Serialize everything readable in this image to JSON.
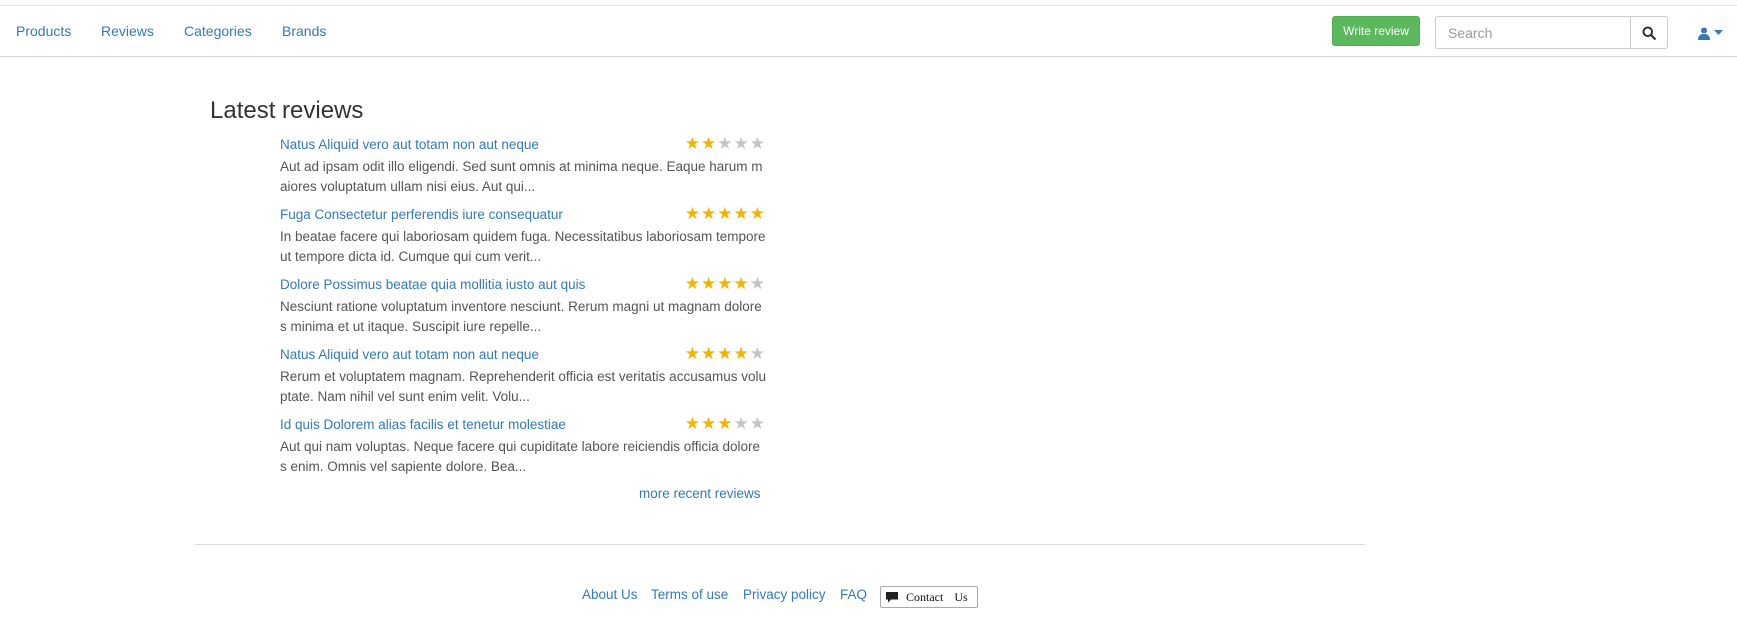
{
  "nav": {
    "items": [
      {
        "label": "Products"
      },
      {
        "label": "Reviews"
      },
      {
        "label": "Categories"
      },
      {
        "label": "Brands"
      }
    ],
    "write_review_label": "Write review",
    "search_placeholder": "Search"
  },
  "main": {
    "heading": "Latest reviews",
    "reviews": [
      {
        "title": "Natus Aliquid vero aut totam non aut neque",
        "rating": 2,
        "max_rating": 5,
        "body": "Aut ad ipsam odit illo eligendi. Sed sunt omnis at minima neque. Eaque harum maiores voluptatum ullam nisi eius. Aut qui..."
      },
      {
        "title": "Fuga Consectetur perferendis iure consequatur",
        "rating": 5,
        "max_rating": 5,
        "body": "In beatae facere qui laboriosam quidem fuga. Necessitatibus laboriosam tempore ut tempore dicta id. Cumque qui cum verit..."
      },
      {
        "title": "Dolore Possimus beatae quia mollitia iusto aut quis",
        "rating": 4,
        "max_rating": 5,
        "body": "Nesciunt ratione voluptatum inventore nesciunt. Rerum magni ut magnam dolores minima et ut itaque. Suscipit iure repelle..."
      },
      {
        "title": "Natus Aliquid vero aut totam non aut neque",
        "rating": 4,
        "max_rating": 5,
        "body": "Rerum et voluptatem magnam. Reprehenderit officia est veritatis accusamus voluptate. Nam nihil vel sunt enim velit. Volu..."
      },
      {
        "title": "Id quis Dolorem alias facilis et tenetur molestiae",
        "rating": 3,
        "max_rating": 5,
        "body": "Aut qui nam voluptas. Neque facere qui cupiditate labore reiciendis officia dolores enim. Omnis vel sapiente dolore. Bea..."
      }
    ],
    "more_label": "more recent reviews"
  },
  "footer": {
    "links": [
      {
        "label": "About Us"
      },
      {
        "label": "Terms of use"
      },
      {
        "label": "Privacy policy"
      },
      {
        "label": "FAQ"
      }
    ],
    "contact_label": "Contact Us"
  },
  "colors": {
    "link": "#337ab7",
    "write_button": "#5cb85c",
    "star_filled": "#f5b301",
    "star_empty": "#c4c4c4"
  },
  "icons": {
    "search": "search-icon",
    "user": "user-icon",
    "caret": "caret-down-icon",
    "chat": "chat-bubble-icon"
  }
}
